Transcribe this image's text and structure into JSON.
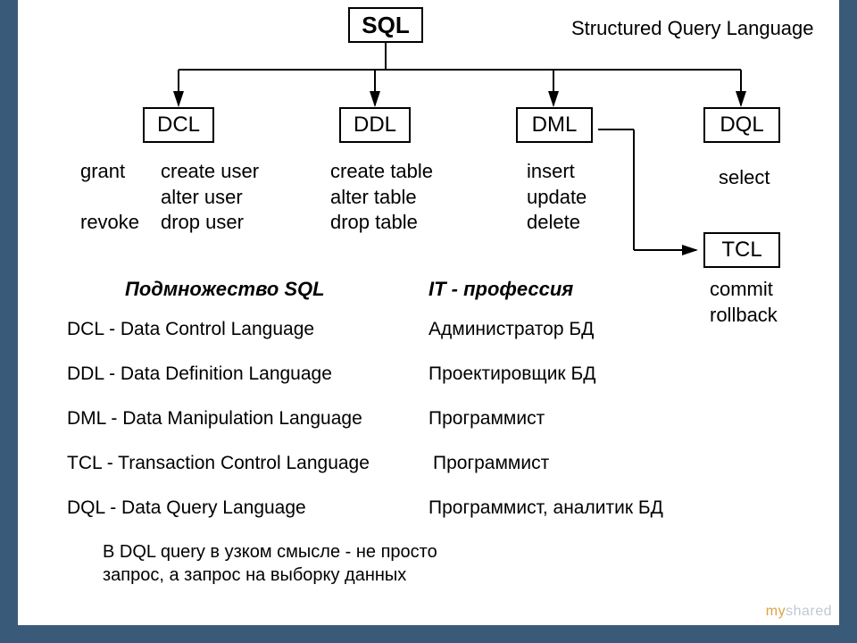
{
  "root": {
    "label": "SQL",
    "fullname": "Structured Query Language"
  },
  "branches": {
    "dcl": {
      "label": "DCL",
      "cmds_col1": "grant\n\nrevoke",
      "cmds_col2": "create user\nalter user\ndrop user"
    },
    "ddl": {
      "label": "DDL",
      "cmds": "create table\nalter table\ndrop table"
    },
    "dml": {
      "label": "DML",
      "cmds": "insert\nupdate\ndelete"
    },
    "dql": {
      "label": "DQL",
      "cmds": "select"
    },
    "tcl": {
      "label": "TCL",
      "cmds": "commit\nrollback"
    }
  },
  "subset_heading": "Подмножество SQL",
  "subset": [
    "DCL - Data Control Language",
    "DDL - Data Definition Language",
    "DML - Data Manipulation Language",
    "TCL - Transaction Control Language",
    "DQL - Data Query Language"
  ],
  "profession_heading": "IT - профессия",
  "professions": [
    "Администратор БД",
    "Проектировщик БД",
    "Программист",
    "Программист",
    "Программист, аналитик БД"
  ],
  "footnote": "В DQL query в узком смысле - не просто\nзапрос, а запрос на выборку данных",
  "watermark_my": "my",
  "watermark_shared": "shared"
}
